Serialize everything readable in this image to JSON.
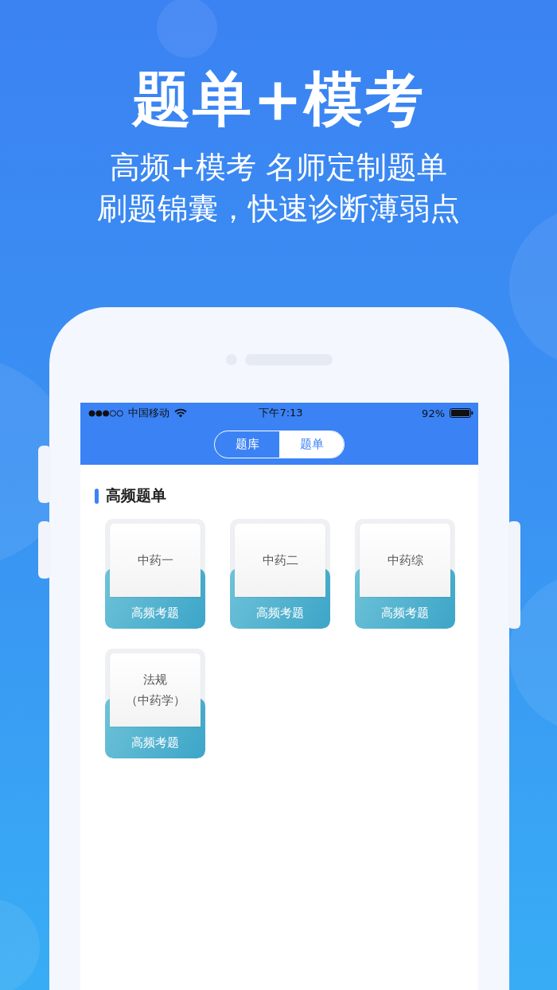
{
  "headline": "题单+模考",
  "subtitle_lines": [
    "高频+模考 名师定制题单",
    "刷题锦囊，快速诊断薄弱点"
  ],
  "status_bar": {
    "carrier": "中国移动",
    "time": "下午7:13",
    "battery": "92%"
  },
  "tabs": [
    {
      "label": "题库",
      "selected": false
    },
    {
      "label": "题单",
      "selected": true
    }
  ],
  "section_title": "高频题单",
  "cards": [
    {
      "lines": [
        "中药一"
      ],
      "label": "高频考题"
    },
    {
      "lines": [
        "中药二"
      ],
      "label": "高频考题"
    },
    {
      "lines": [
        "中药综"
      ],
      "label": "高频考题"
    },
    {
      "lines": [
        "法规",
        "（中药学）"
      ],
      "label": "高频考题"
    }
  ]
}
